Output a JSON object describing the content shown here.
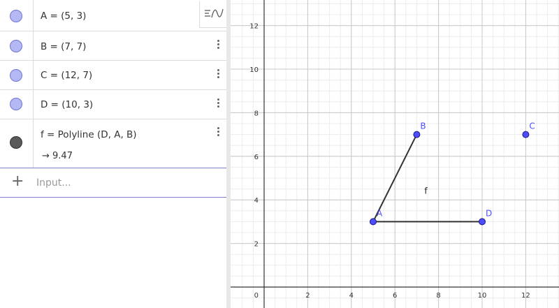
{
  "algebra": {
    "rows": [
      {
        "definition": "A = (5, 3)",
        "type": "point"
      },
      {
        "definition": "B = (7, 7)",
        "type": "point"
      },
      {
        "definition": "C = (12, 7)",
        "type": "point"
      },
      {
        "definition": "D = (10, 3)",
        "type": "point"
      },
      {
        "definition": "f = Polyline (D, A, B)",
        "output": "→  9.47",
        "type": "line"
      }
    ],
    "input_placeholder": "Input...",
    "plus_symbol": "+"
  },
  "graphics": {
    "x_ticks": [
      "2",
      "4",
      "6",
      "8",
      "10",
      "12"
    ],
    "y_ticks": [
      "2",
      "4",
      "6",
      "8",
      "10",
      "12"
    ],
    "origin_label": "0",
    "points": [
      {
        "name": "A",
        "x": 5,
        "y": 3
      },
      {
        "name": "B",
        "x": 7,
        "y": 7
      },
      {
        "name": "C",
        "x": 12,
        "y": 7
      },
      {
        "name": "D",
        "x": 10,
        "y": 3
      }
    ],
    "polyline": {
      "name": "f",
      "vertices": [
        "D",
        "A",
        "B"
      ]
    },
    "point_color": "#4d4dff",
    "line_color": "#333333"
  }
}
